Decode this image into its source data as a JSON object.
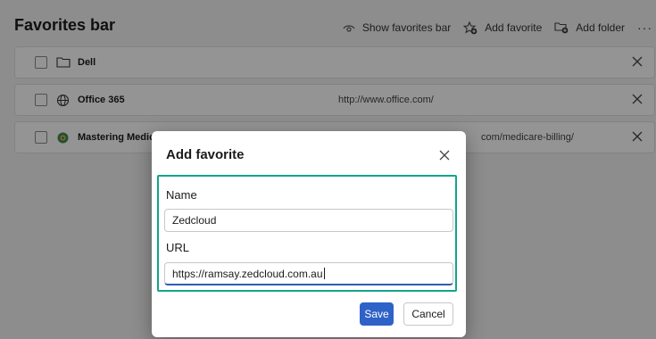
{
  "header": {
    "title": "Favorites bar",
    "toolbar": {
      "show_favorites_bar": "Show favorites bar",
      "add_favorite": "Add favorite",
      "add_folder": "Add folder",
      "more": "···"
    }
  },
  "favorites": [
    {
      "name": "Dell",
      "url": "",
      "icon": "folder-icon"
    },
    {
      "name": "Office 365",
      "url": "http://www.office.com/",
      "icon": "globe-icon"
    },
    {
      "name": "Mastering Medic",
      "url": "com/medicare-billing/",
      "icon": "site-favicon-icon"
    }
  ],
  "dialog": {
    "title": "Add favorite",
    "name_label": "Name",
    "name_value": "Zedcloud",
    "url_label": "URL",
    "url_value": "https://ramsay.zedcloud.com.au",
    "save_label": "Save",
    "cancel_label": "Cancel"
  },
  "colors": {
    "accent": "#2f62c8",
    "focus_outline": "#13a58a"
  }
}
